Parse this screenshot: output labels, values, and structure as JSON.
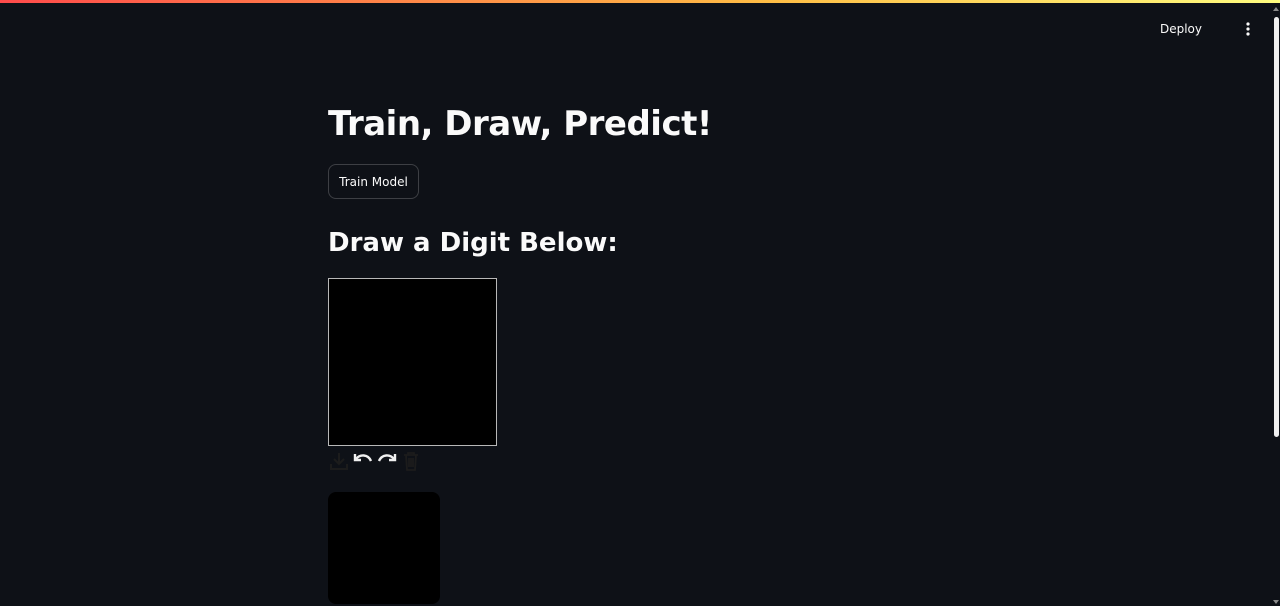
{
  "header": {
    "deploy_label": "Deploy",
    "menu_icon": "kebab-menu-icon"
  },
  "main": {
    "title": "Train, Draw, Predict!",
    "train_button_label": "Train Model",
    "subtitle": "Draw a Digit Below:"
  },
  "canvas": {
    "background": "#000000",
    "border_color": "#b8b8b8"
  },
  "toolbar": {
    "tools": [
      "download-icon",
      "undo-icon",
      "redo-icon",
      "trash-icon"
    ]
  },
  "preview": {
    "background": "#000000"
  },
  "colors": {
    "app_background": "#0e1117",
    "text": "#fafafa",
    "accent_gradient_start": "#ff4b4b",
    "accent_gradient_end": "#fffd80"
  }
}
